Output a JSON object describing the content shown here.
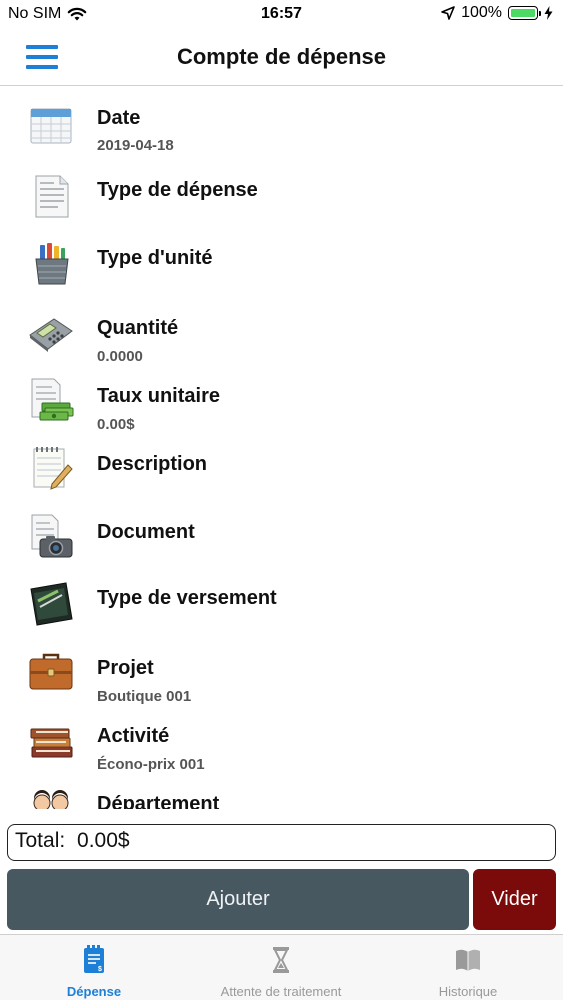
{
  "status_bar": {
    "carrier": "No SIM",
    "time": "16:57",
    "battery_percent": "100%",
    "icons": [
      "wifi-icon",
      "location-arrow-icon",
      "battery-icon",
      "charging-bolt-icon"
    ]
  },
  "header": {
    "title": "Compte de dépense",
    "menu_icon": "hamburger-menu-icon"
  },
  "form": {
    "rows": [
      {
        "label": "Date",
        "value": "2019-04-18",
        "icon": "calendar-icon"
      },
      {
        "label": "Type de dépense",
        "value": "",
        "icon": "invoice-icon"
      },
      {
        "label": "Type d'unité",
        "value": "",
        "icon": "tools-basket-icon"
      },
      {
        "label": "Quantité",
        "value": "0.0000",
        "icon": "calculator-icon"
      },
      {
        "label": "Taux unitaire",
        "value": "0.00$",
        "icon": "money-document-icon"
      },
      {
        "label": "Description",
        "value": "",
        "icon": "notepad-pen-icon"
      },
      {
        "label": "Document",
        "value": "",
        "icon": "camera-document-icon"
      },
      {
        "label": "Type de versement",
        "value": "",
        "icon": "wallet-icon"
      },
      {
        "label": "Projet",
        "value": "Boutique 001",
        "icon": "briefcase-icon"
      },
      {
        "label": "Activité",
        "value": "Écono-prix 001",
        "icon": "books-icon"
      },
      {
        "label": "Département",
        "value": "",
        "icon": "people-icon"
      }
    ]
  },
  "total": {
    "label": "Total:",
    "value": "0.00$"
  },
  "actions": {
    "add_label": "Ajouter",
    "clear_label": "Vider"
  },
  "tabs": [
    {
      "label": "Dépense",
      "icon": "expense-document-icon",
      "active": true
    },
    {
      "label": "Attente de traitement",
      "icon": "hourglass-icon",
      "active": false
    },
    {
      "label": "Historique",
      "icon": "open-book-icon",
      "active": false
    }
  ],
  "colors": {
    "accent": "#1e7fd6",
    "add_button": "#475861",
    "clear_button": "#7b0a0a"
  }
}
